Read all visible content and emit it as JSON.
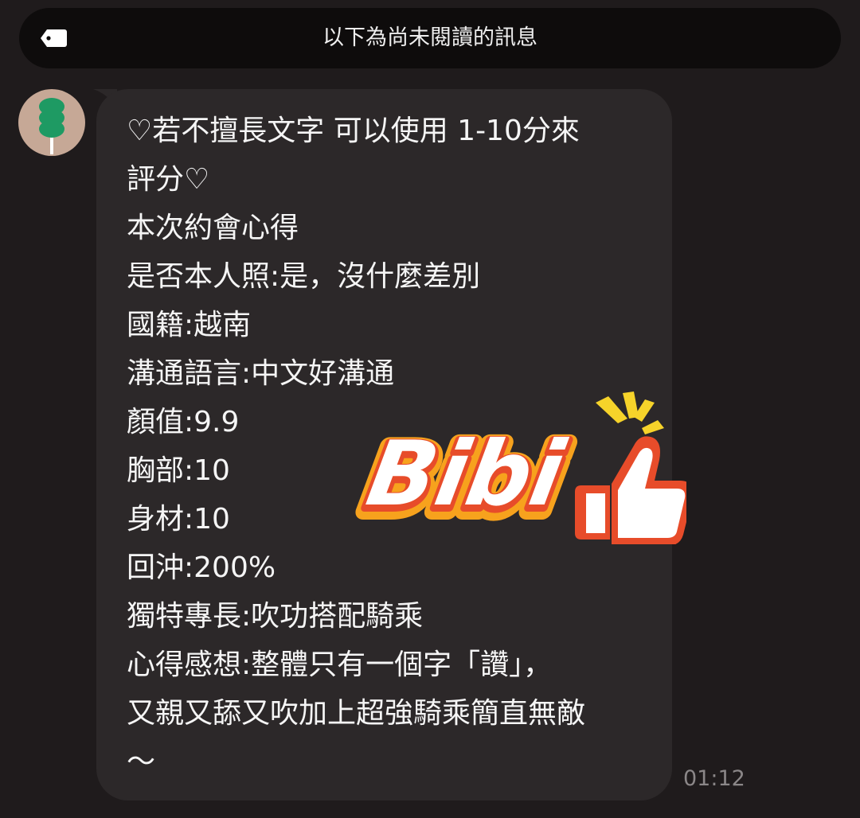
{
  "unread_banner": {
    "text": "以下為尚未閱讀的訊息",
    "icon": "tag-icon"
  },
  "message": {
    "avatar_icon": "green-tanghulu-avatar",
    "lines": [
      "♡若不擅長文字 可以使用 1-10分來",
      "評分♡",
      "本次約會心得",
      "是否本人照:是，沒什麼差別",
      "國籍:越南",
      "溝通語言:中文好溝通",
      "顏值:9.9",
      "胸部:10",
      "身材:10",
      "回沖:200%",
      "獨特專長:吹功搭配騎乘",
      "心得感想:整體只有一個字「讚」，",
      "又親又舔又吹加上超強騎乘簡直無敵",
      "～"
    ],
    "timestamp": "01:12"
  },
  "sticker": {
    "text": "Bibi",
    "icon": "thumbs-up-icon",
    "colors": {
      "fill": "#ffffff",
      "orange": "#f7a21d",
      "red": "#e74c2a",
      "rays": "#f6d32a"
    }
  }
}
